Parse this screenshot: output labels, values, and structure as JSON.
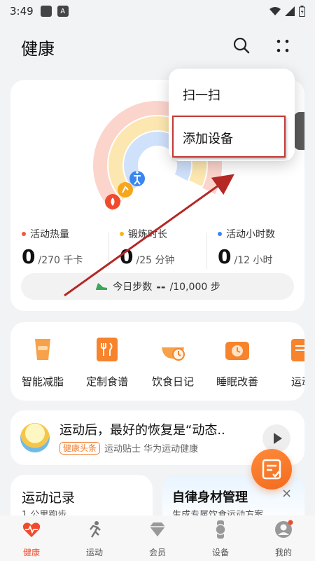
{
  "status_bar": {
    "time": "3:49",
    "a_icon": "A"
  },
  "header": {
    "title": "健康",
    "icons": [
      "search-icon",
      "more-icon"
    ]
  },
  "popup_menu": {
    "items": [
      "扫一扫",
      "添加设备"
    ]
  },
  "metrics": [
    {
      "label": "活动热量",
      "value": "0",
      "unit": "/270 千卡",
      "color": "#f05a3c"
    },
    {
      "label": "锻炼时长",
      "value": "0",
      "unit": "/25 分钟",
      "color": "#f6b61c"
    },
    {
      "label": "活动小时数",
      "value": "0",
      "unit": "/12 小时",
      "color": "#3a86f0"
    }
  ],
  "steps": {
    "label": "今日步数",
    "value": "--",
    "goal": "/10,000 步"
  },
  "tools": [
    "智能减脂",
    "定制食谱",
    "饮食日记",
    "睡眠改善",
    "运动"
  ],
  "news": {
    "title": "运动后，最好的恢复是“动态..",
    "badge": "健康头条",
    "source": "运动贴士 华为运动健康"
  },
  "cards": {
    "record_title": "运动记录",
    "record_sub": "1 公里跑步",
    "plan_title": "自律身材管理",
    "plan_sub": "生成专属饮食运动方案",
    "close": "×"
  },
  "nav": [
    "健康",
    "运动",
    "会员",
    "设备",
    "我的"
  ],
  "colors": {
    "accent": "#f04a2c",
    "highlight": "#c23a35"
  }
}
